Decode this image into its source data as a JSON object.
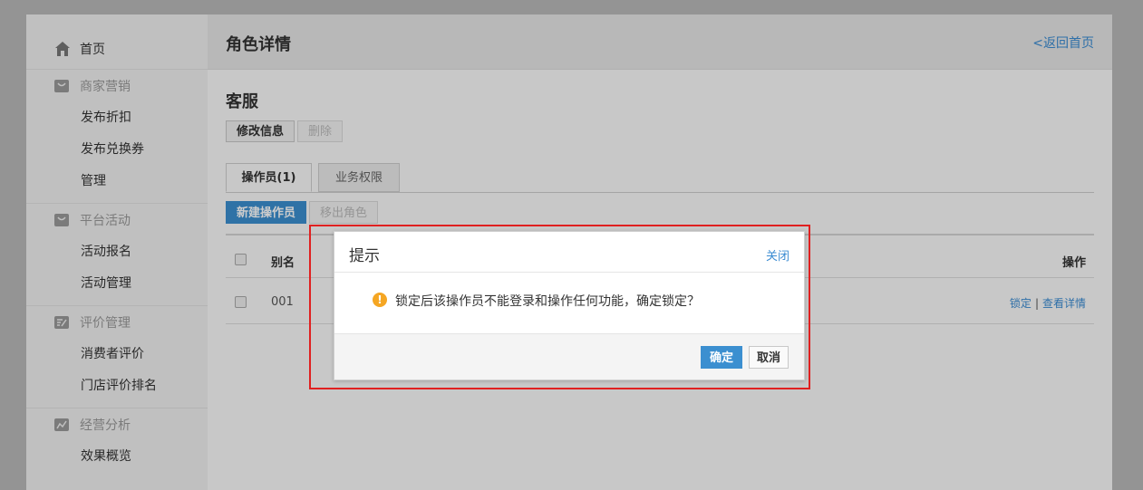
{
  "sidebar": {
    "home": "首页",
    "groups": [
      {
        "title": "商家营销",
        "icon": "bag-icon",
        "items": [
          "发布折扣",
          "发布兑换券",
          "管理"
        ]
      },
      {
        "title": "平台活动",
        "icon": "bag-icon",
        "items": [
          "活动报名",
          "活动管理"
        ]
      },
      {
        "title": "评价管理",
        "icon": "edit-icon",
        "items": [
          "消费者评价",
          "门店评价排名"
        ]
      },
      {
        "title": "经营分析",
        "icon": "chart-icon",
        "items": [
          "效果概览"
        ]
      }
    ]
  },
  "header": {
    "title": "角色详情",
    "back": "<返回首页"
  },
  "role": {
    "name": "客服",
    "edit": "修改信息",
    "delete": "删除"
  },
  "tabs": [
    {
      "label": "操作员(1)"
    },
    {
      "label": "业务权限"
    }
  ],
  "toolbar": {
    "new_operator": "新建操作员",
    "remove_role": "移出角色"
  },
  "table": {
    "columns": {
      "alias": "别名",
      "ops": "操作"
    },
    "rows": [
      {
        "alias": "001",
        "lock": "锁定",
        "sep": "|",
        "view": "查看详情"
      }
    ]
  },
  "dialog": {
    "title": "提示",
    "close": "关闭",
    "message": "锁定后该操作员不能登录和操作任何功能，确定锁定？",
    "warn_glyph": "!",
    "ok": "确定",
    "cancel": "取消"
  },
  "colors": {
    "accent": "#3b8fd0",
    "highlight": "#e02020",
    "warning": "#f5a623"
  }
}
